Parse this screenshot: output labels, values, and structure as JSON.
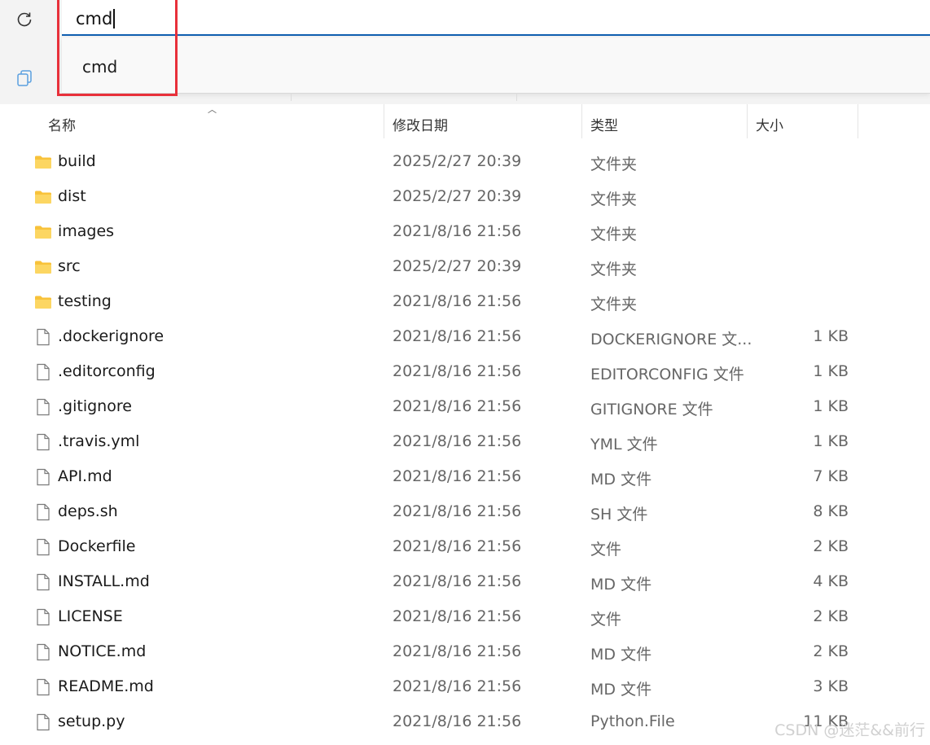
{
  "address": {
    "value": "cmd",
    "suggestion": "cmd"
  },
  "columns": {
    "name": "名称",
    "date": "修改日期",
    "type": "类型",
    "size": "大小"
  },
  "files": [
    {
      "name": "build",
      "date": "2025/2/27 20:39",
      "type": "文件夹",
      "size": "",
      "icon": "folder-icon"
    },
    {
      "name": "dist",
      "date": "2025/2/27 20:39",
      "type": "文件夹",
      "size": "",
      "icon": "folder-icon"
    },
    {
      "name": "images",
      "date": "2021/8/16 21:56",
      "type": "文件夹",
      "size": "",
      "icon": "folder-icon"
    },
    {
      "name": "src",
      "date": "2025/2/27 20:39",
      "type": "文件夹",
      "size": "",
      "icon": "folder-icon"
    },
    {
      "name": "testing",
      "date": "2021/8/16 21:56",
      "type": "文件夹",
      "size": "",
      "icon": "folder-icon"
    },
    {
      "name": ".dockerignore",
      "date": "2021/8/16 21:56",
      "type": "DOCKERIGNORE 文...",
      "size": "1 KB",
      "icon": "file-icon"
    },
    {
      "name": ".editorconfig",
      "date": "2021/8/16 21:56",
      "type": "EDITORCONFIG 文件",
      "size": "1 KB",
      "icon": "file-icon"
    },
    {
      "name": ".gitignore",
      "date": "2021/8/16 21:56",
      "type": "GITIGNORE 文件",
      "size": "1 KB",
      "icon": "file-icon"
    },
    {
      "name": ".travis.yml",
      "date": "2021/8/16 21:56",
      "type": "YML 文件",
      "size": "1 KB",
      "icon": "file-icon"
    },
    {
      "name": "API.md",
      "date": "2021/8/16 21:56",
      "type": "MD 文件",
      "size": "7 KB",
      "icon": "file-icon"
    },
    {
      "name": "deps.sh",
      "date": "2021/8/16 21:56",
      "type": "SH 文件",
      "size": "8 KB",
      "icon": "file-icon"
    },
    {
      "name": "Dockerfile",
      "date": "2021/8/16 21:56",
      "type": "文件",
      "size": "2 KB",
      "icon": "file-icon"
    },
    {
      "name": "INSTALL.md",
      "date": "2021/8/16 21:56",
      "type": "MD 文件",
      "size": "4 KB",
      "icon": "file-icon"
    },
    {
      "name": "LICENSE",
      "date": "2021/8/16 21:56",
      "type": "文件",
      "size": "2 KB",
      "icon": "file-icon"
    },
    {
      "name": "NOTICE.md",
      "date": "2021/8/16 21:56",
      "type": "MD 文件",
      "size": "2 KB",
      "icon": "file-icon"
    },
    {
      "name": "README.md",
      "date": "2021/8/16 21:56",
      "type": "MD 文件",
      "size": "3 KB",
      "icon": "file-icon"
    },
    {
      "name": "setup.py",
      "date": "2021/8/16 21:56",
      "type": "Python.File",
      "size": "11 KB",
      "icon": "file-icon"
    }
  ],
  "watermark": "CSDN @迷茫&&前行",
  "colors": {
    "accent": "#0f5fb0",
    "highlight_box": "#e8303a",
    "folder": "#f8c23a"
  }
}
